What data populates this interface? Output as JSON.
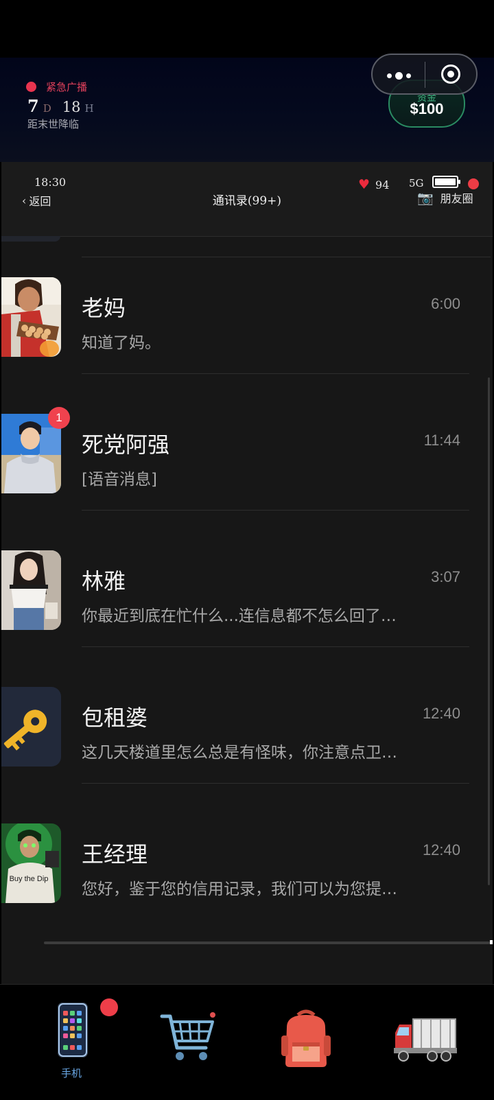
{
  "hud": {
    "emergency_label": "紧急广播",
    "days_value": "7",
    "days_unit": "D",
    "hours_value": "18",
    "hours_unit": "H",
    "countdown_caption": "距末世降临",
    "funds_label": "资金",
    "funds_value": "$100"
  },
  "status_bar": {
    "time": "18:30",
    "back_label": "返回",
    "title": "通讯录(99+)",
    "health_value": "94",
    "network": "5G",
    "moments_label": "朋友圈"
  },
  "contacts": [
    {
      "name": "老妈",
      "time": "6:00",
      "preview": "知道了妈。"
    },
    {
      "name": "死党阿强",
      "time": "11:44",
      "preview": "[语音消息]",
      "unread": "1"
    },
    {
      "name": "林雅",
      "time": "3:07",
      "preview": "你最近到底在忙什么...连信息都不怎么回了…"
    },
    {
      "name": "包租婆",
      "time": "12:40",
      "preview": "这几天楼道里怎么总是有怪味，你注意点卫…"
    },
    {
      "name": "王经理",
      "time": "12:40",
      "preview": "您好，鉴于您的信用记录，我们可以为您提…"
    }
  ],
  "avatar_texts": {
    "wang_shirt": "Buy the Dip"
  },
  "bottom_nav": {
    "phone_label": "手机",
    "icons": [
      "phone-icon",
      "shopping-cart-icon",
      "backpack-icon",
      "truck-icon"
    ]
  },
  "colors": {
    "alert_red": "#e8344f",
    "funds_green": "#3fb27f",
    "badge_red": "#f0424e",
    "nav_label_blue": "#6aa8e6",
    "list_background": "#171717"
  }
}
